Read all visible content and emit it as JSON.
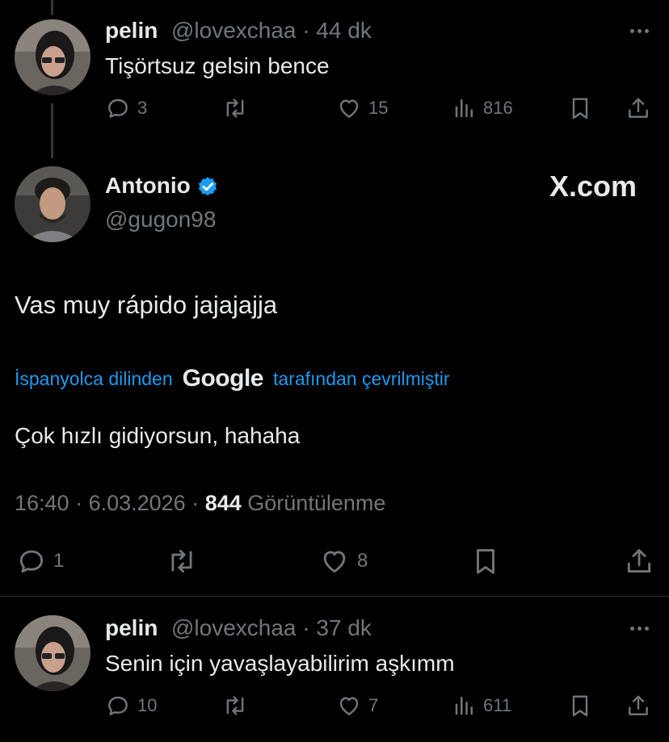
{
  "reply1": {
    "name": "pelin",
    "handle": "@lovexchaa",
    "time": "44 dk",
    "text": "Tişörtsuz gelsin bence",
    "replies": "3",
    "likes": "15",
    "views": "816"
  },
  "main": {
    "name": "Antonio",
    "handle": "@gugon98",
    "watermark": "X.com",
    "text": "Vas muy rápido jajajajja",
    "translate_prefix": "İspanyolca dilinden",
    "translate_brand": "Google",
    "translate_suffix": "tarafından çevrilmiştir",
    "translation": "Çok hızlı gidiyorsun, hahaha",
    "time": "16:40",
    "date": "6.03.2026",
    "views_count": "844",
    "views_label": "Görüntülenme",
    "replies": "1",
    "likes": "8"
  },
  "reply2": {
    "name": "pelin",
    "handle": "@lovexchaa",
    "time": "37 dk",
    "text": "Senin için yavaşlayabilirim aşkımm",
    "replies": "10",
    "likes": "7",
    "views": "611"
  },
  "colors": {
    "background": "#000000",
    "text": "#e7e9ea",
    "muted": "#71767b",
    "link": "#1d9bf0",
    "verified": "#1d9bf0"
  }
}
